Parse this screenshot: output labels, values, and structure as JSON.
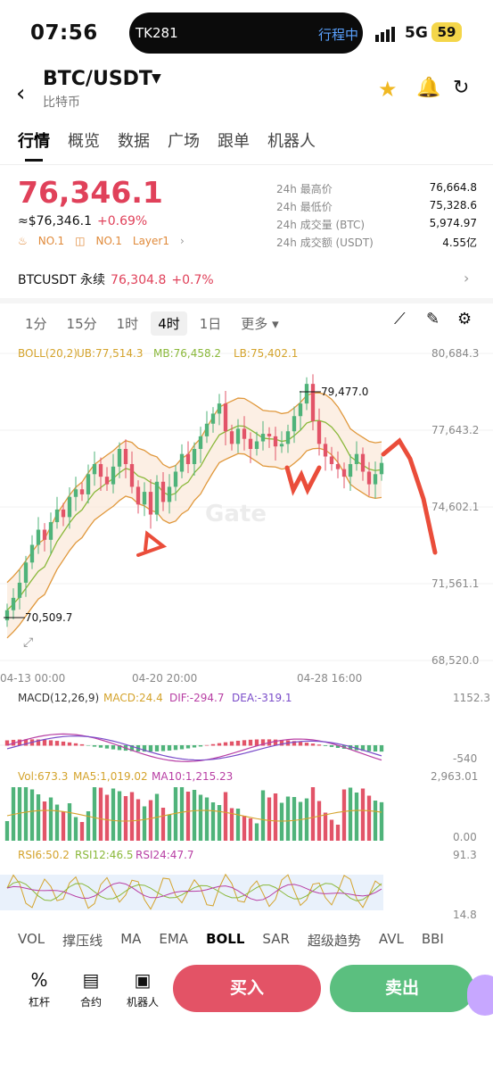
{
  "status": {
    "time": "07:56",
    "island_left": "TK281",
    "island_right": "行程中",
    "network": "5G",
    "battery": "59"
  },
  "header": {
    "pair": "BTC/USDT",
    "subtitle": "比特币"
  },
  "tabs": [
    "行情",
    "概览",
    "数据",
    "广场",
    "跟单",
    "机器人"
  ],
  "ticker": {
    "price": "76,346.1",
    "usd": "≈$76,346.1",
    "change": "+0.69%",
    "rank1": "NO.1",
    "rank2": "NO.1",
    "tag": "Layer1"
  },
  "stats": [
    {
      "label": "24h 最高价",
      "value": "76,664.8"
    },
    {
      "label": "24h 最低价",
      "value": "75,328.6"
    },
    {
      "label": "24h 成交量 (BTC)",
      "value": "5,974.97"
    },
    {
      "label": "24h 成交额 (USDT)",
      "value": "4.55亿"
    }
  ],
  "perp": {
    "name": "BTCUSDT 永续",
    "price": "76,304.8",
    "change": "+0.7%"
  },
  "intervals": [
    "1分",
    "15分",
    "1时",
    "4时",
    "1日",
    "更多"
  ],
  "indicators": [
    "VOL",
    "撑压线",
    "MA",
    "EMA",
    "BOLL",
    "SAR",
    "超级趋势",
    "AVL",
    "BBI"
  ],
  "actions": {
    "leverage": "杠杆",
    "contract": "合约",
    "bot": "机器人",
    "buy": "买入",
    "sell": "卖出"
  },
  "chart_data": {
    "type": "candlestick",
    "boll_label": "BOLL(20,2)",
    "ub": "UB:77,514.3",
    "mb": "MB:76,458.2",
    "lb": "LB:75,402.1",
    "y_ticks": [
      "80,684.3",
      "77,643.2",
      "74,602.1",
      "71,561.1",
      "68,520.0"
    ],
    "y_range": [
      68520,
      80684.3
    ],
    "x_ticks": [
      "04-13 00:00",
      "04-20 20:00",
      "04-28 16:00"
    ],
    "high_marker": "79,477.0",
    "low_marker": "70,509.7",
    "closes": [
      70509.7,
      71000,
      71600,
      72400,
      73100,
      73700,
      73300,
      74000,
      74500,
      74200,
      75000,
      75300,
      75100,
      75900,
      76300,
      75800,
      75500,
      76200,
      76900,
      76300,
      75400,
      74700,
      75200,
      74300,
      75600,
      74800,
      75400,
      76000,
      76700,
      76300,
      76900,
      77400,
      77900,
      78300,
      78700,
      77600,
      77100,
      77700,
      77300,
      76900,
      77200,
      77500,
      77400,
      77000,
      77100,
      77600,
      78200,
      78700,
      79477,
      78000,
      77100,
      76600,
      76300,
      76100,
      75800,
      76300,
      76700,
      76000,
      75500,
      75900,
      76346.1
    ],
    "macd_label": "MACD(12,26,9)",
    "macd_val": "MACD:24.4",
    "dif": "DIF:-294.7",
    "dea": "DEA:-319.1",
    "macd_max": "1152.3",
    "macd_min": "-540",
    "vol_label": "Vol:673.3",
    "ma5": "MA5:1,019.02",
    "ma10": "MA10:1,215.23",
    "vol_max": "2,963.01",
    "vol_min": "0.00",
    "rsi6": "RSI6:50.2",
    "rsi12": "RSI12:46.5",
    "rsi24": "RSI24:47.7",
    "rsi_max": "91.3",
    "rsi_min": "14.8",
    "watermark": "Gate"
  }
}
